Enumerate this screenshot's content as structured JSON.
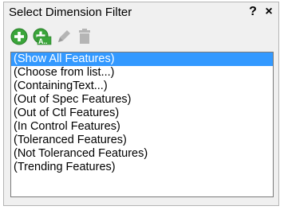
{
  "window": {
    "title": "Select Dimension Filter",
    "help_label": "?",
    "close_label": "×"
  },
  "toolbar": {
    "add_icon": "add-icon",
    "add_all_icon": "add-all-icon",
    "add_all_label": "A..",
    "edit_icon": "pencil-icon",
    "delete_icon": "trash-icon"
  },
  "filters": {
    "selected_index": 0,
    "items": [
      {
        "label": "(Show All Features)"
      },
      {
        "label": "(Choose from list...)"
      },
      {
        "label": "(ContainingText...)"
      },
      {
        "label": "(Out of Spec Features)"
      },
      {
        "label": "(Out of Ctl Features)"
      },
      {
        "label": "(In Control Features)"
      },
      {
        "label": "(Toleranced Features)"
      },
      {
        "label": "(Not Toleranced Features)"
      },
      {
        "label": "(Trending Features)"
      }
    ]
  },
  "colors": {
    "selection": "#3399ff",
    "add_green": "#3aa53a",
    "disabled_gray": "#b5b5b5"
  }
}
